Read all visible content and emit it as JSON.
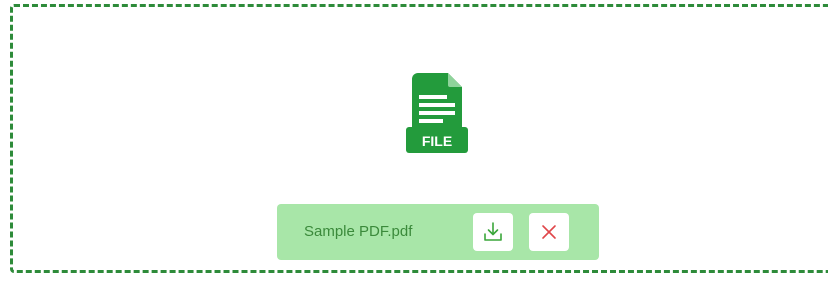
{
  "upload": {
    "icon_label": "FILE",
    "file_name": "Sample PDF.pdf",
    "icons": {
      "file": "file-icon",
      "download": "download-icon",
      "remove": "close-icon"
    }
  },
  "colors": {
    "accent": "#2e8b3a",
    "file_icon": "#239b3c",
    "chip_background": "#a8e6a8",
    "chip_text": "#3b8a3b",
    "download_icon": "#3aa63a",
    "remove_icon": "#e0464a"
  }
}
